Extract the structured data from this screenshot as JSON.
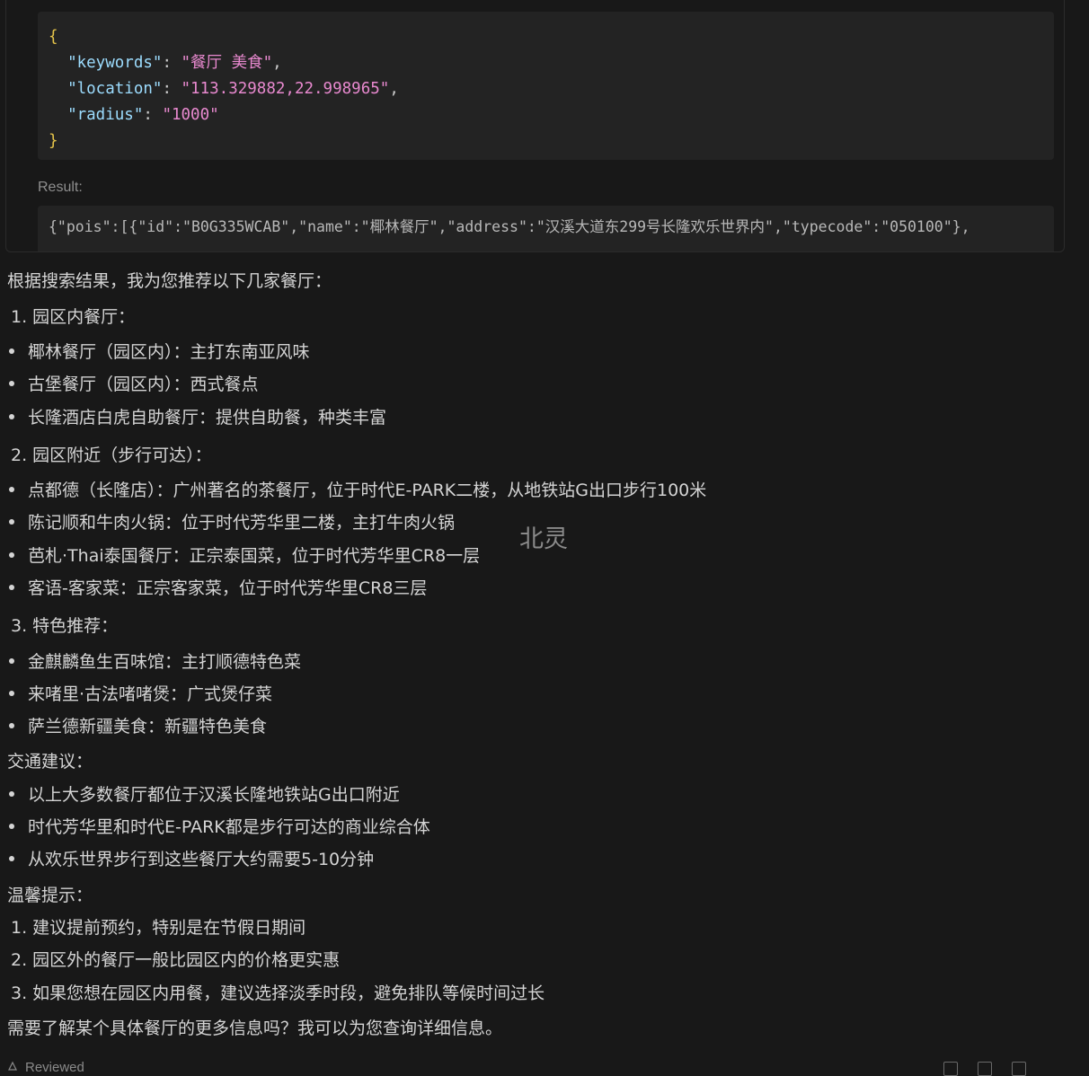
{
  "tool_call": {
    "args_lines": [
      {
        "key": "\"keywords\"",
        "value": "\"餐厅 美食\""
      },
      {
        "key": "\"location\"",
        "value": "\"113.329882,22.998965\""
      },
      {
        "key": "\"radius\"",
        "value": "\"1000\""
      }
    ],
    "open_brace": "{",
    "close_brace": "}",
    "result_label": "Result:",
    "result_text": "{\"pois\":[{\"id\":\"B0G335WCAB\",\"name\":\"椰林餐厅\",\"address\":\"汉溪大道东299号长隆欢乐世界内\",\"typecode\":\"050100\"},"
  },
  "answer": {
    "intro": "根据搜索结果，我为您推荐以下几家餐厅：",
    "section1_title": "1. 园区内餐厅：",
    "section1_items": [
      "椰林餐厅（园区内）：主打东南亚风味",
      "古堡餐厅（园区内）：西式餐点",
      "长隆酒店白虎自助餐厅：提供自助餐，种类丰富"
    ],
    "section2_title": "2. 园区附近（步行可达）：",
    "section2_items": [
      "点都德（长隆店）：广州著名的茶餐厅，位于时代E-PARK二楼，从地铁站G出口步行100米",
      "陈记顺和牛肉火锅：位于时代芳华里二楼，主打牛肉火锅",
      "芭札·Thai泰国餐厅：正宗泰国菜，位于时代芳华里CR8一层",
      "客语-客家菜：正宗客家菜，位于时代芳华里CR8三层"
    ],
    "section3_title": "3. 特色推荐：",
    "section3_items": [
      "金麒麟鱼生百味馆：主打顺德特色菜",
      "来啫里·古法啫啫煲：广式煲仔菜",
      "萨兰德新疆美食：新疆特色美食"
    ],
    "transport_title": "交通建议：",
    "transport_items": [
      "以上大多数餐厅都位于汉溪长隆地铁站G出口附近",
      "时代芳华里和时代E-PARK都是步行可达的商业综合体",
      "从欢乐世界步行到这些餐厅大约需要5-10分钟"
    ],
    "tips_title": "温馨提示：",
    "tips_items": [
      "1. 建议提前预约，特别是在节假日期间",
      "2. 园区外的餐厅一般比园区内的价格更实惠",
      "3. 如果您想在园区内用餐，建议选择淡季时段，避免排队等候时间过长"
    ],
    "closing": "需要了解某个具体餐厅的更多信息吗？我可以为您查询详细信息。"
  },
  "watermark": "北灵",
  "footer": {
    "label": "Reviewed"
  }
}
